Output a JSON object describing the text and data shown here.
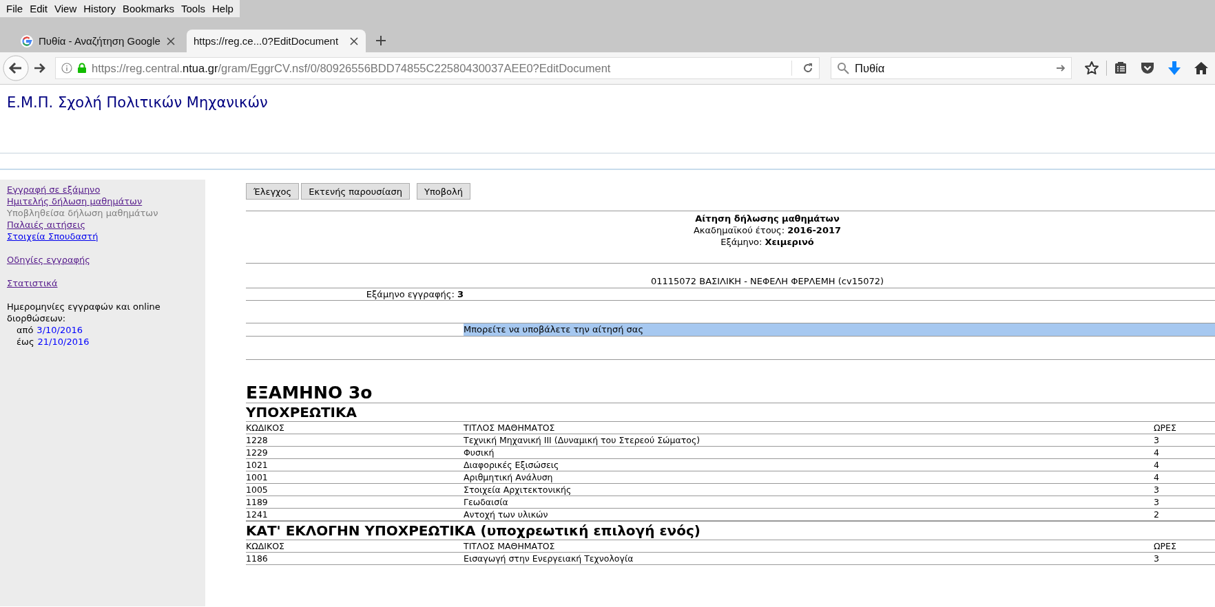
{
  "menu_bar": [
    "File",
    "Edit",
    "View",
    "History",
    "Bookmarks",
    "Tools",
    "Help"
  ],
  "tabs": [
    {
      "title": "Πυθία - Αναζήτηση Google",
      "selected": false,
      "favicon": true
    },
    {
      "title": "https://reg.ce...0?EditDocument",
      "selected": true,
      "favicon": false
    }
  ],
  "address_bar": {
    "url_start": "https://reg.central.",
    "url_domain": "ntua.gr",
    "url_path": "/gram/EggrCV.nsf/0/80926556BDD74855C22580430037AEE0?EditDocument"
  },
  "search_field": {
    "value": "Πυθία"
  },
  "site_title": "Ε.Μ.Π. Σχολή Πολιτικών Μηχανικών",
  "sidebar": {
    "groups": [
      [
        {
          "label": "Εγγραφή σε εξάμηνο",
          "kind": "visited"
        },
        {
          "label": "Ημιτελής δήλωση μαθημάτων",
          "kind": "visited"
        },
        {
          "label": "Υποβληθείσα δήλωση μαθημάτων",
          "kind": "current"
        },
        {
          "label": "Παλαιές αιτήσεις",
          "kind": "visited"
        },
        {
          "label": "Στοιχεία Σπουδαστή",
          "kind": "link"
        }
      ],
      [
        {
          "label": "Οδηγίες εγγραφής",
          "kind": "visited"
        }
      ],
      [
        {
          "label": "Στατιστικά",
          "kind": "visited"
        }
      ]
    ],
    "dates_note": "Ημερομηνίες εγγραφών και online διορθώσεων:",
    "dates": [
      {
        "label": "από",
        "date": "3/10/2016"
      },
      {
        "label": "έως",
        "date": "21/10/2016"
      }
    ]
  },
  "button_groups": [
    [
      "Έλεγχος",
      "Εκτενής παρουσίαση"
    ],
    [
      "Υποβολή"
    ]
  ],
  "form_header": {
    "title": "Αίτηση δήλωσης μαθημάτων",
    "lines": [
      "Ακαδημαϊκού έτους: **2016-2017**",
      "Εξάμηνο: **Χειμερινό**"
    ]
  },
  "student": "01115072 ΒΑΣΙΛΙΚΗ - ΝΕΦΕΛΗ ΦΕΡΛΕΜΗ (cv15072)",
  "enrollment_semester": "Εξάμηνο εγγραφής: **3**",
  "message": "Μπορείτε να υποβάλετε την αίτησή σας",
  "semester_heading": "ΕΞΑΜΗΝΟ 3ο",
  "sections": [
    {
      "title": "ΥΠΟΧΡΕΩΤΙΚΑ",
      "columns": [
        "ΚΩΔΙΚΟΣ",
        "ΤΙΤΛΟΣ ΜΑΘΗΜΑΤΟΣ",
        "ΩΡΕΣ"
      ],
      "rows": [
        [
          "1228",
          "Τεχνική Μηχανική ΙΙΙ (Δυναμική του Στερεού Σώματος)",
          "3"
        ],
        [
          "1229",
          "Φυσική",
          "4"
        ],
        [
          "1021",
          "Διαφορικές Εξισώσεις",
          "4"
        ],
        [
          "1001",
          "Αριθμητική Ανάλυση",
          "4"
        ],
        [
          "1005",
          "Στοιχεία Αρχιτεκτονικής",
          "3"
        ],
        [
          "1189",
          "Γεωδαισία",
          "3"
        ],
        [
          "1241",
          "Αντοχή των υλικών",
          "2"
        ]
      ]
    },
    {
      "title": "ΚΑΤ' ΕΚΛΟΓΗΝ ΥΠΟΧΡΕΩΤΙΚΑ (υποχρεωτική επιλογή ενός)",
      "columns": [
        "ΚΩΔΙΚΟΣ",
        "ΤΙΤΛΟΣ ΜΑΘΗΜΑΤΟΣ",
        "ΩΡΕΣ"
      ],
      "rows": [
        [
          "1186",
          "Εισαγωγή στην Ενεργειακή Τεχνολογία",
          "3"
        ]
      ]
    }
  ]
}
